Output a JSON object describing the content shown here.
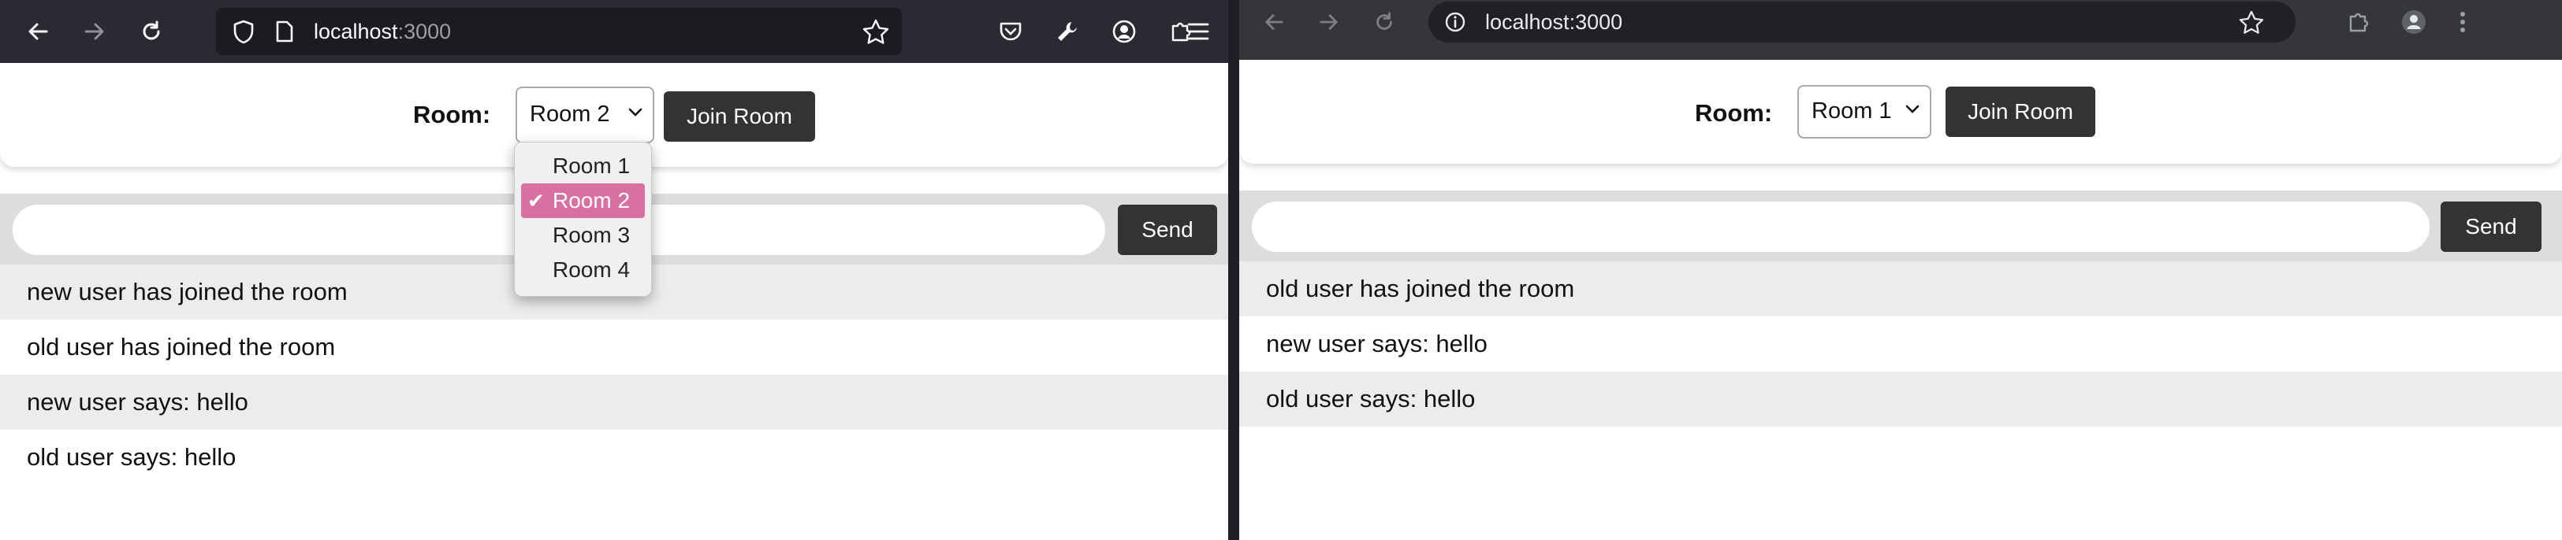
{
  "left_window": {
    "url_host": "localhost",
    "url_port": ":3000",
    "room_label": "Room:",
    "selected_room": "Room 2",
    "join_label": "Join Room",
    "send_label": "Send",
    "input_value": "",
    "dropdown_options": [
      {
        "label": "Room 1",
        "selected": false
      },
      {
        "label": "Room 2",
        "selected": true
      },
      {
        "label": "Room 3",
        "selected": false
      },
      {
        "label": "Room 4",
        "selected": false
      }
    ],
    "messages": [
      "new user has joined the room",
      "old user has joined the room",
      "new user says: hello",
      "old user says: hello"
    ]
  },
  "right_window": {
    "url": "localhost:3000",
    "room_label": "Room:",
    "selected_room": "Room 1",
    "join_label": "Join Room",
    "send_label": "Send",
    "input_value": "",
    "messages": [
      "old user has joined the room",
      "new user says: hello",
      "old user says: hello"
    ]
  },
  "colors": {
    "selected_option": "#d870a1",
    "button_dark": "#333333",
    "firefox_toolbar": "#2b2a33",
    "chrome_toolbar": "#35363a"
  }
}
